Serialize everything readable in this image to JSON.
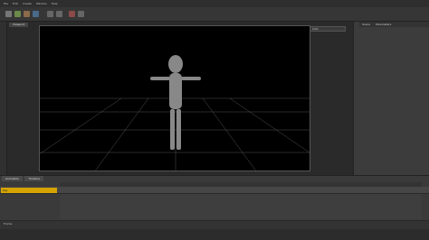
{
  "menubar": {
    "items": [
      "File",
      "Edit",
      "Create",
      "Window",
      "Help"
    ]
  },
  "viewport": {
    "tab": "Viewport",
    "selector": "Cam"
  },
  "scene_panel": {
    "tabs": [
      "Scene",
      "Parameters"
    ]
  },
  "timeline": {
    "tabs": [
      "Animation",
      "Timeline"
    ],
    "key_label": "Key",
    "frame_label": "Frame"
  }
}
